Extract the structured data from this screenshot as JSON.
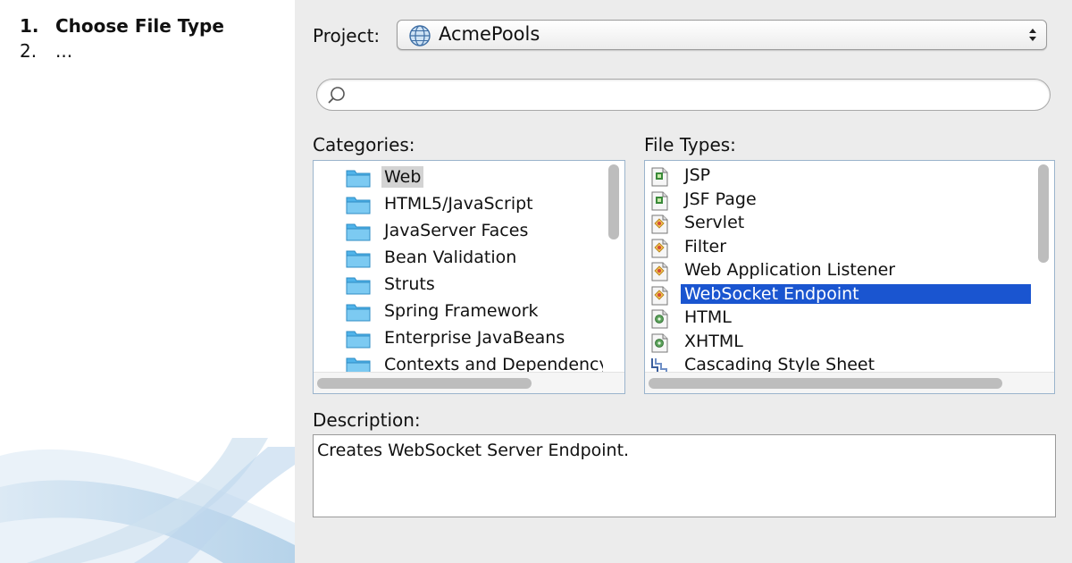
{
  "steps": [
    {
      "num": "1.",
      "label": "Choose File Type"
    },
    {
      "num": "2.",
      "label": "..."
    }
  ],
  "project": {
    "label": "Project:",
    "value": "AcmePools"
  },
  "search": {
    "value": ""
  },
  "categories": {
    "label": "Categories:",
    "items": [
      "Web",
      "HTML5/JavaScript",
      "JavaServer Faces",
      "Bean Validation",
      "Struts",
      "Spring Framework",
      "Enterprise JavaBeans",
      "Contexts and Dependency"
    ],
    "selected": "Web"
  },
  "file_types": {
    "label": "File Types:",
    "items": [
      {
        "label": "JSP",
        "icon": "jsp-file-icon"
      },
      {
        "label": "JSF Page",
        "icon": "jsf-file-icon"
      },
      {
        "label": "Servlet",
        "icon": "servlet-file-icon"
      },
      {
        "label": "Filter",
        "icon": "filter-file-icon"
      },
      {
        "label": "Web Application Listener",
        "icon": "listener-file-icon"
      },
      {
        "label": "WebSocket Endpoint",
        "icon": "websocket-file-icon"
      },
      {
        "label": "HTML",
        "icon": "html-file-icon"
      },
      {
        "label": "XHTML",
        "icon": "xhtml-file-icon"
      },
      {
        "label": "Cascading Style Sheet",
        "icon": "css-file-icon"
      }
    ],
    "selected": "WebSocket Endpoint"
  },
  "description": {
    "label": "Description:",
    "text": "Creates WebSocket Server Endpoint."
  },
  "colors": {
    "selection": "#1a55d0",
    "category_selection": "#d3d3d3",
    "folder": "#4fb3ea"
  }
}
